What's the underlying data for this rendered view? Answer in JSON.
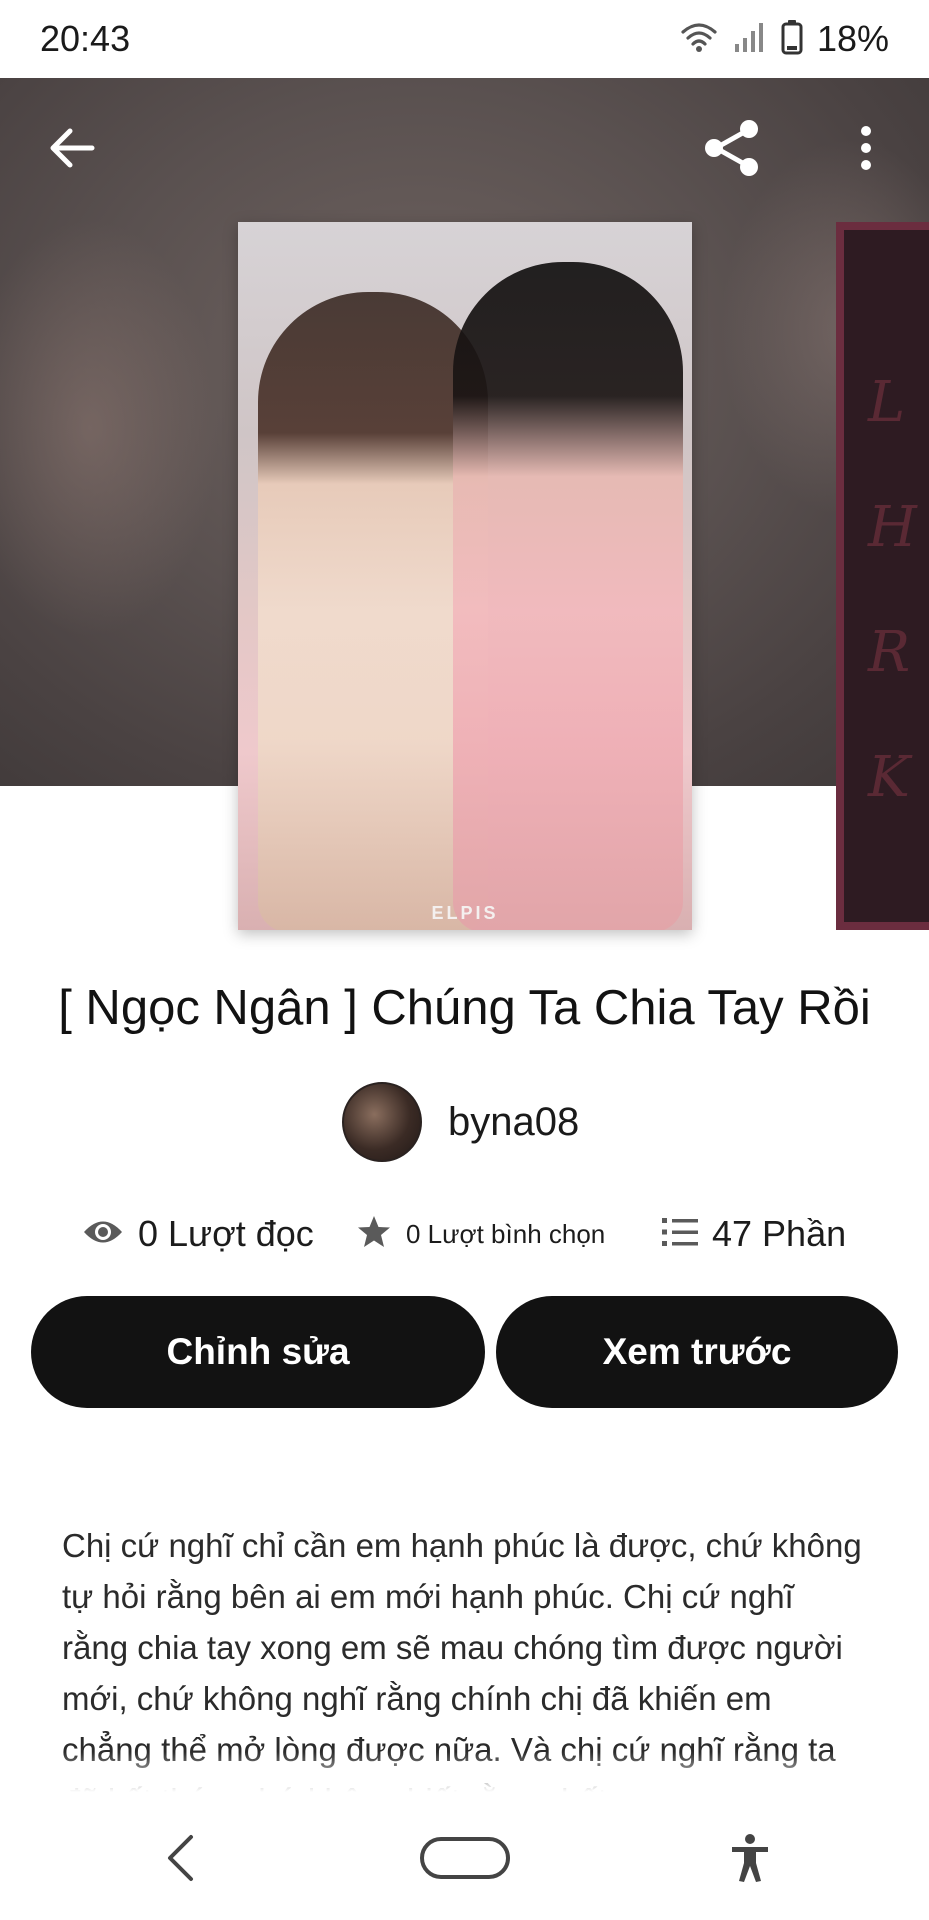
{
  "status_bar": {
    "time": "20:43",
    "battery_percent": "18%"
  },
  "story": {
    "title": "[ Ngọc Ngân ] Chúng Ta Chia Tay Rồi",
    "cover_watermark": "ELPIS",
    "side_cover_letters": [
      "L",
      "H",
      "R",
      "K"
    ],
    "author": "byna08",
    "reads": "0 Lượt đọc",
    "votes": "0 Lượt bình chọn",
    "parts": "47 Phần",
    "description": "Chị cứ nghĩ chỉ cần em hạnh phúc là được, chứ không tự hỏi rằng bên ai em mới hạnh phúc. Chị cứ nghĩ rằng chia tay xong em sẽ mau chóng tìm được người mới, chứ không nghĩ rằng chính chị đã khiến em chẳng thể mở lòng được nữa. Và chị cứ nghĩ rằng ta đã kết thúc, chứ không biết rằng chết"
  },
  "actions": {
    "edit_label": "Chỉnh sửa",
    "preview_label": "Xem trước"
  },
  "icons": {
    "back": "arrow-left-icon",
    "share": "share-icon",
    "more": "more-vertical-icon",
    "reads": "eye-icon",
    "votes": "star-icon",
    "parts": "list-icon",
    "nav_back": "chevron-left-icon",
    "nav_home": "home-pill-icon",
    "nav_accessibility": "accessibility-icon"
  },
  "colors": {
    "button_bg": "#121212",
    "button_text": "#ffffff",
    "side_cover_border": "#6b2d3f"
  }
}
